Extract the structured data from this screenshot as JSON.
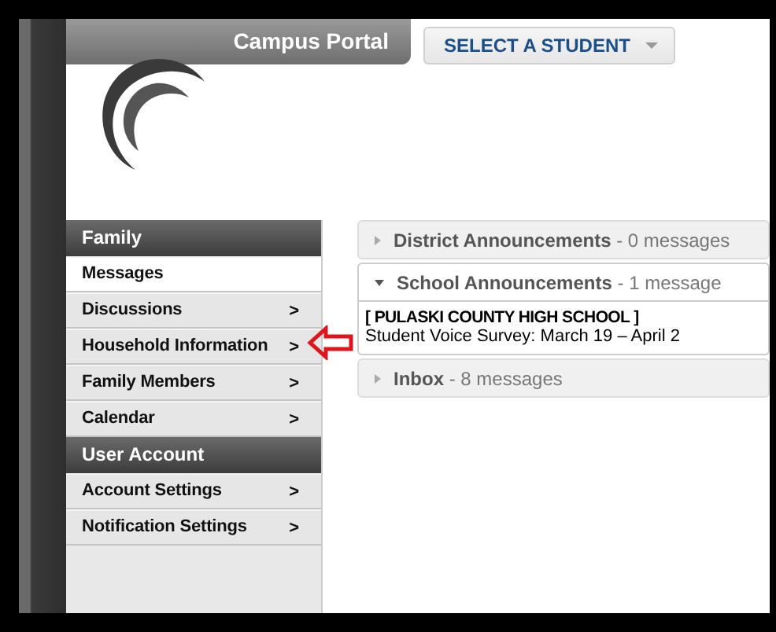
{
  "header": {
    "title": "Campus Portal",
    "student_select": {
      "label": "SELECT A STUDENT"
    }
  },
  "sidebar": {
    "sections": [
      {
        "title": "Family",
        "items": [
          {
            "label": "Messages",
            "selected": true
          },
          {
            "label": "Discussions",
            "selected": false,
            "chevron": ">"
          },
          {
            "label": "Household Information",
            "selected": false,
            "chevron": ">"
          },
          {
            "label": "Family Members",
            "selected": false,
            "chevron": ">"
          },
          {
            "label": "Calendar",
            "selected": false,
            "chevron": ">"
          }
        ]
      },
      {
        "title": "User Account",
        "items": [
          {
            "label": "Account Settings",
            "selected": false,
            "chevron": ">"
          },
          {
            "label": "Notification Settings",
            "selected": false,
            "chevron": ">"
          }
        ]
      }
    ]
  },
  "panels": [
    {
      "title": "District Announcements",
      "count": "- 0 messages",
      "expanded": false
    },
    {
      "title": "School Announcements",
      "count": "- 1 message",
      "expanded": true,
      "content": [
        {
          "school": "[ PULASKI COUNTY HIGH SCHOOL ]",
          "text": "Student Voice Survey: March 19 – April 2"
        }
      ]
    },
    {
      "title": "Inbox",
      "count": "- 8 messages",
      "expanded": false
    }
  ]
}
